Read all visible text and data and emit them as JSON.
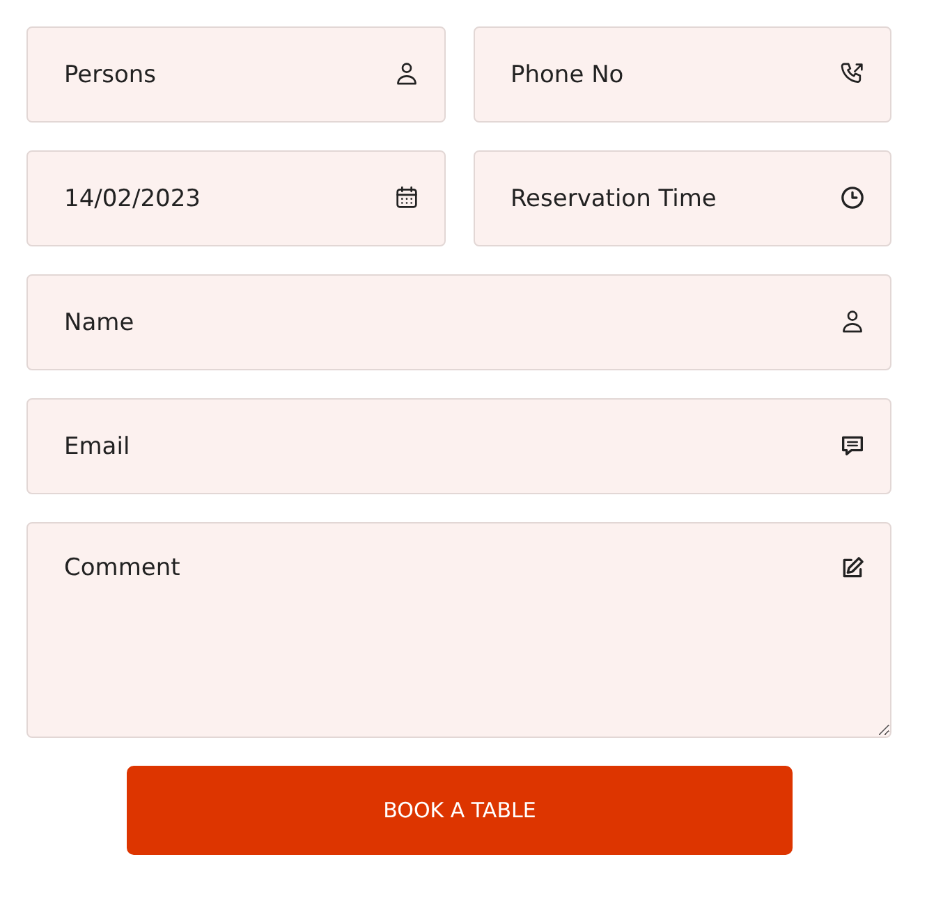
{
  "rows": [
    [
      {
        "kind": "number",
        "placeholder": "Persons"
      },
      {
        "kind": "tel",
        "placeholder": "Phone No"
      }
    ],
    [
      {
        "kind": "date",
        "value": "14/02/2023"
      },
      {
        "kind": "time",
        "placeholder": "Reservation Time"
      }
    ],
    [
      {
        "kind": "text",
        "placeholder": "Name"
      }
    ],
    [
      {
        "kind": "email",
        "placeholder": "Email"
      }
    ],
    [
      {
        "kind": "textarea",
        "placeholder": "Comment"
      }
    ]
  ],
  "submit": {
    "label": "BOOK A TABLE"
  }
}
